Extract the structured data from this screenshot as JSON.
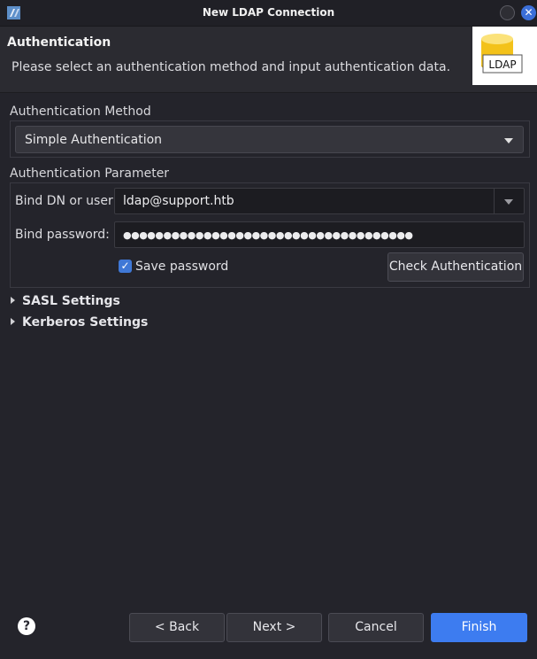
{
  "window": {
    "title": "New LDAP Connection"
  },
  "header": {
    "title": "Authentication",
    "description": "Please select an authentication method and input authentication data.",
    "logo_text": "LDAP"
  },
  "auth_method": {
    "group_label": "Authentication Method",
    "selected": "Simple Authentication"
  },
  "auth_parameter": {
    "group_label": "Authentication Parameter",
    "bind_dn_label": "Bind DN or user:",
    "bind_dn_value": "ldap@support.htb",
    "bind_password_label": "Bind password:",
    "bind_password_value": "●●●●●●●●●●●●●●●●●●●●●●●●●●●●●●●●●●●●",
    "save_password_label": "Save password",
    "save_password_checked": true,
    "check_button": "Check Authentication"
  },
  "sections": [
    {
      "label": "SASL Settings"
    },
    {
      "label": "Kerberos Settings"
    }
  ],
  "footer": {
    "help_icon": "?",
    "back": "< Back",
    "next": "Next >",
    "cancel": "Cancel",
    "finish": "Finish"
  },
  "colors": {
    "accent": "#3d7cf0",
    "background": "#24242b"
  }
}
